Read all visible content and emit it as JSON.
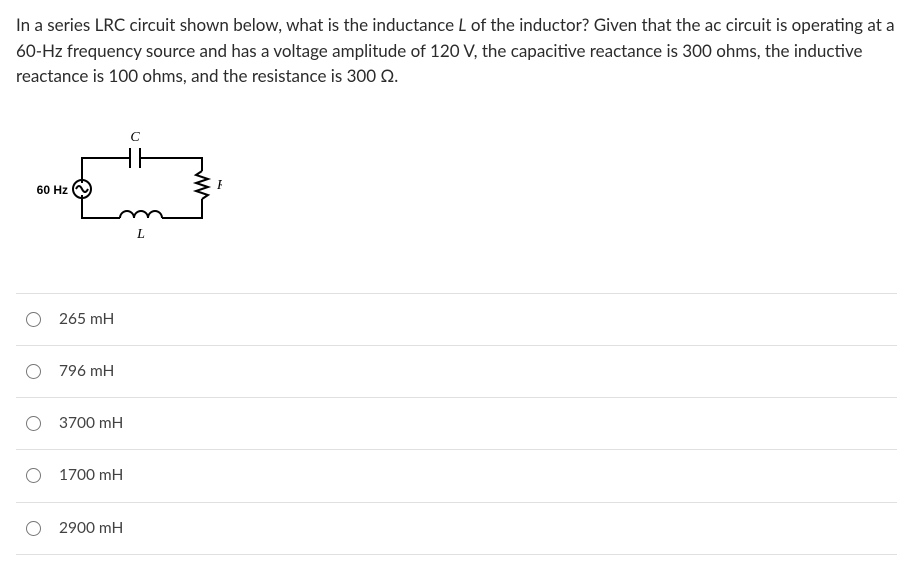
{
  "question": {
    "intro": "In a series LRC circuit shown below, what is the inductance ",
    "varL": "L",
    "after_varL": " of the inductor? Given that the ac circuit is operating at a 60-Hz frequency source and has a voltage amplitude of 120 V, the capacitive reactance is 300 ohms, the inductive reactance is 100 ohms, and the resistance is ",
    "resistance_value": "300 Ω",
    "period": "."
  },
  "diagram": {
    "source_label_freq": "60 Hz",
    "cap_label": "C",
    "res_label": "R",
    "ind_label": "L"
  },
  "options": [
    {
      "label": "265 mH"
    },
    {
      "label": "796 mH"
    },
    {
      "label": "3700 mH"
    },
    {
      "label": "1700 mH"
    },
    {
      "label": "2900 mH"
    }
  ]
}
